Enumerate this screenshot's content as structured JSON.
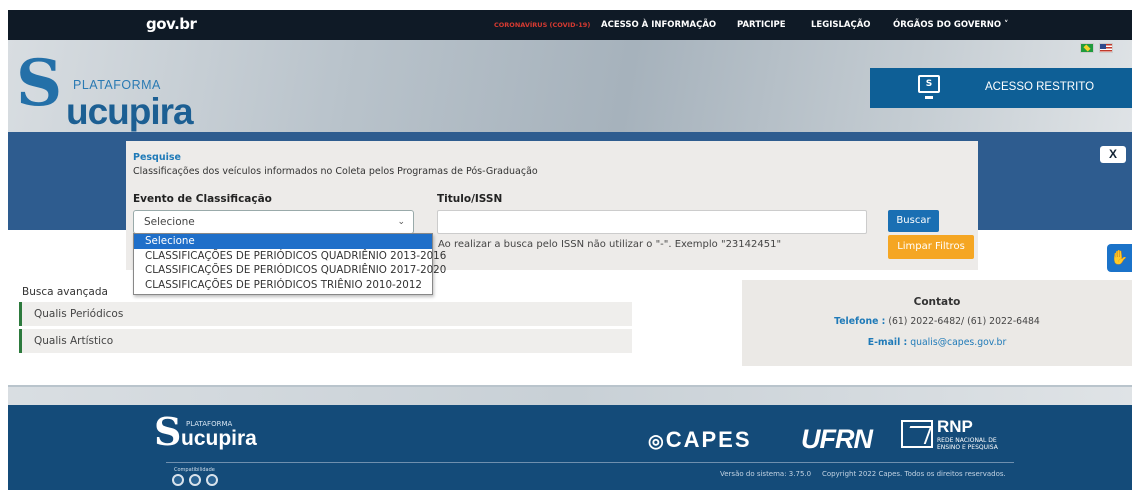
{
  "govbar": {
    "logo": "gov.br",
    "links": [
      "CORONAVÍRUS (COVID-19)",
      "ACESSO À INFORMAÇÃO",
      "PARTICIPE",
      "LEGISLAÇÃO",
      "ÓRGÃOS DO GOVERNO"
    ],
    "dropdown_icon": "chevron-down-icon",
    "colors": {
      "bar": "#0f1a26",
      "covid": "#d63a31"
    }
  },
  "header": {
    "logo_s": "S",
    "logo_plataforma": "PLATAFORMA",
    "logo_name": "ucupira",
    "flags": [
      "brazil-flag-icon",
      "usa-flag-icon"
    ],
    "acesso_restrito": "ACESSO RESTRITO",
    "monitor_glyph": "S",
    "colors": {
      "acesso_bg": "#0e5f96",
      "band": "#2e5c8f"
    }
  },
  "close_button": "X",
  "search": {
    "title": "Pesquise",
    "subtitle": "Classificações dos veículos informados no Coleta pelos Programas de Pós-Graduação",
    "evento_label": "Evento de Classificação",
    "evento_value": "Selecione",
    "titulo_label": "Titulo/ISSN",
    "titulo_value": "",
    "hint": "Ao realizar a busca pelo ISSN não utilizar o \"-\". Exemplo \"23142451\"",
    "buscar": "Buscar",
    "limpar": "Limpar Filtros",
    "options": [
      "Selecione",
      "CLASSIFICAÇÕES DE PERIÓDICOS QUADRIÊNIO 2013-2016",
      "CLASSIFICAÇÕES DE PERIÓDICOS QUADRIÊNIO 2017-2020",
      "CLASSIFICAÇÕES DE PERIÓDICOS TRIÊNIO 2010-2012"
    ],
    "selected_index": 0,
    "colors": {
      "buscar": "#1a6fb3",
      "limpar": "#f5a623",
      "highlight": "#1f6fc9"
    }
  },
  "menu": {
    "busca_avancada": "Busca avançada",
    "items": [
      "Qualis Periódicos",
      "Qualis Artístico"
    ]
  },
  "contato": {
    "title": "Contato",
    "telefone_label": "Telefone :",
    "telefone_value": "(61) 2022-6482/ (61) 2022-6484",
    "email_label": "E-mail :",
    "email_value": "qualis@capes.gov.br"
  },
  "accessibility_icon": "hand-sign-language-icon",
  "footer": {
    "logo_s": "S",
    "logo_plataforma": "PLATAFORMA",
    "logo_name": "ucupira",
    "capes": "CAPES",
    "ufrn": "UFRN",
    "rnp": "RNP",
    "rnp_sub": "REDE NACIONAL DE ENSINO E PESQUISA",
    "compat": "Compatibilidade",
    "browsers": [
      "chrome-icon",
      "firefox-icon",
      "safari-icon"
    ],
    "version": "Versão do sistema: 3.75.0",
    "copyright": "Copyright 2022 Capes. Todos os direitos reservados.",
    "colors": {
      "footer_bg": "#144b79"
    }
  }
}
